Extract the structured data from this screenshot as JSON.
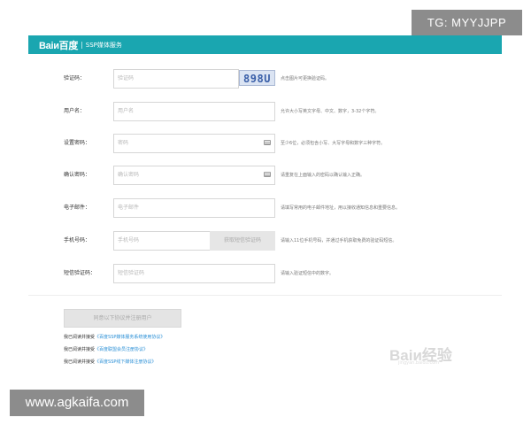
{
  "overlay": {
    "tg_label": "TG: MYYJJPP",
    "site_label": "www.agkaifa.com"
  },
  "header": {
    "logo_text": "Baiи百度",
    "separator": "|",
    "title": "SSP媒体服务",
    "bar_color": "#1aa6b0"
  },
  "form": {
    "captcha": {
      "label": "验证码：",
      "placeholder": "验证码",
      "image_text": "898U",
      "hint": "点击图片可更换验证码。"
    },
    "username": {
      "label": "用户名：",
      "placeholder": "用户名",
      "hint": "允许大小写英文字母、中文、数字，3-32个字符。"
    },
    "password": {
      "label": "设置密码：",
      "placeholder": "密码",
      "hint": "至少6位，必须包含小写、大写字母和数字三种字符。"
    },
    "confirm": {
      "label": "确认密码：",
      "placeholder": "确认密码",
      "hint": "请重复在上面输入的密码以确认输入正确。"
    },
    "email": {
      "label": "电子邮件：",
      "placeholder": "电子邮件",
      "hint": "请填写常用的电子邮件地址，用以接收通知信息和重要信息。"
    },
    "phone": {
      "label": "手机号码：",
      "placeholder": "手机号码",
      "button": "获取短信验证码",
      "hint": "请输入11位手机号码，并通过手机获取免费的验证码短信。"
    },
    "sms": {
      "label": "短信验证码：",
      "placeholder": "短信验证码",
      "hint": "请输入验证短信中的数字。"
    }
  },
  "submit_label": "同意以下协议并注册用户",
  "agreements": [
    {
      "prefix": "我已阅读并接受",
      "link": "《百度SSP媒体服务系统使用协议》"
    },
    {
      "prefix": "我已阅读并接受",
      "link": "《百度联盟会员注册协议》"
    },
    {
      "prefix": "我已阅读并接受",
      "link": "《百度SSP线下媒体注册协议》"
    }
  ],
  "watermark": {
    "text": "Baiи经验",
    "sub": "jingyan.baidu.com"
  }
}
